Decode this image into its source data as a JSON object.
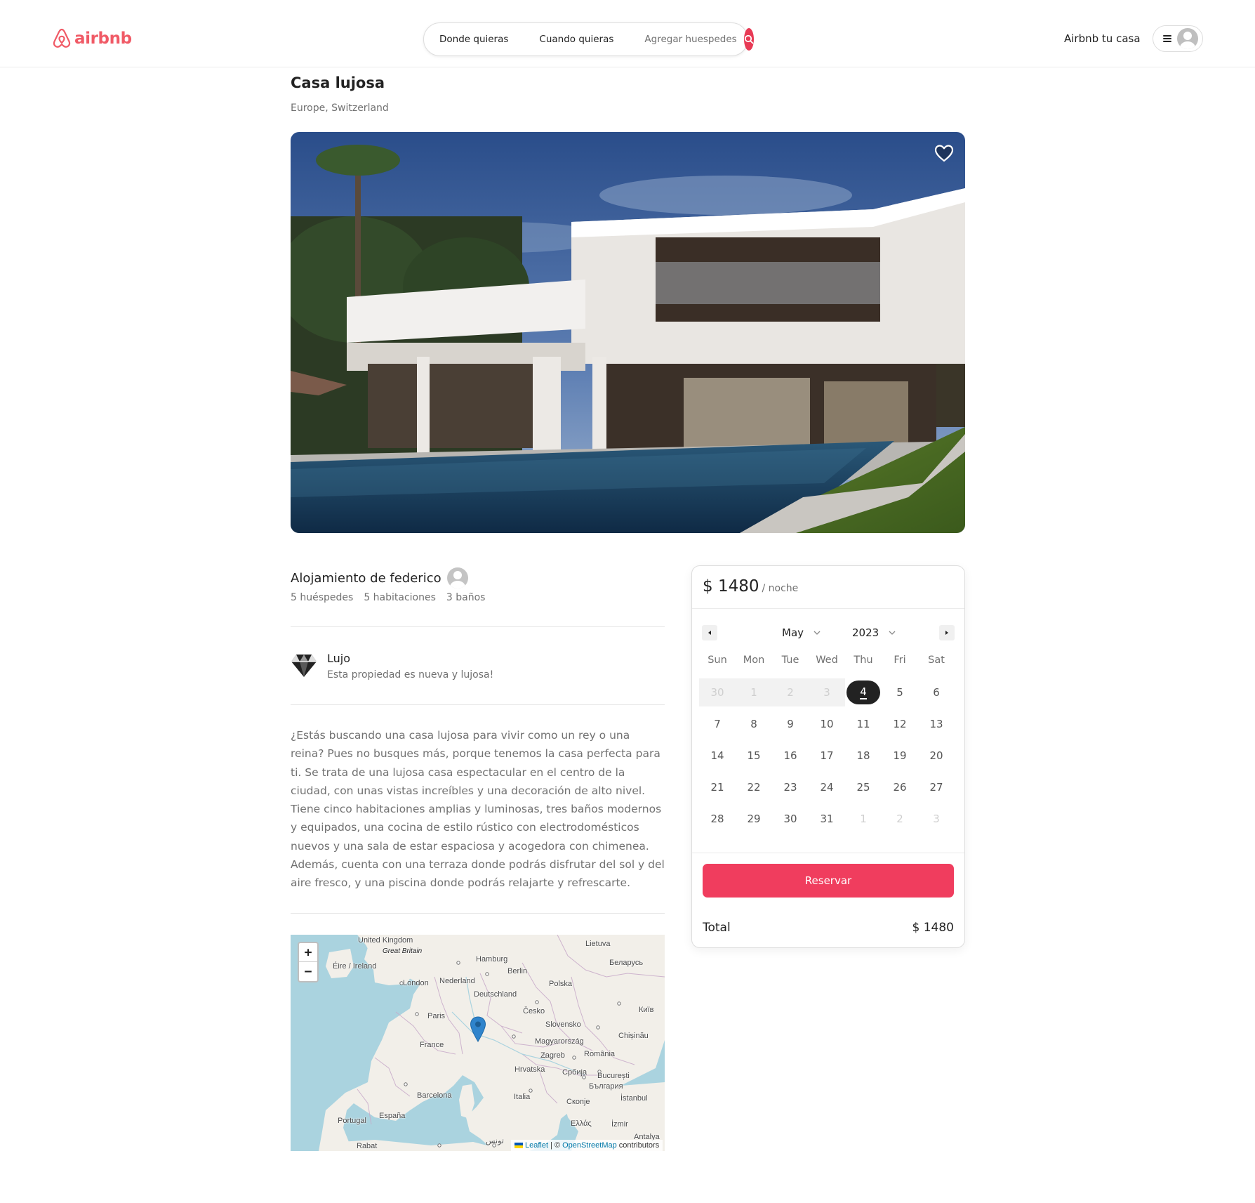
{
  "brand": {
    "name": "airbnb",
    "color": "#f05a66",
    "icon": "airbnb-logo-icon"
  },
  "search": {
    "where": "Donde quieras",
    "when": "Cuando quieras",
    "guests": "Agregar huespedes",
    "button_icon": "search-icon",
    "accent": "#e83a55"
  },
  "nav": {
    "host_link": "Airbnb tu casa",
    "menu_icon": "hamburger-icon",
    "avatar_icon": "user-avatar-icon"
  },
  "listing": {
    "title": "Casa lujosa",
    "location": "Europe, Switzerland",
    "host_line": "Alojamiento de federico",
    "stats": [
      "5 huéspedes",
      "5 habitaciones",
      "3 baños"
    ],
    "amenity": {
      "icon": "diamond-icon",
      "title": "Lujo",
      "description": "Esta propiedad es nueva y lujosa!"
    },
    "description": "¿Estás buscando una casa lujosa para vivir como un rey o una reina? Pues no busques más, porque tenemos la casa perfecta para ti. Se trata de una lujosa casa espectacular en el centro de la ciudad, con unas vistas increíbles y una decoración de alto nivel. Tiene cinco habitaciones amplias y luminosas, tres baños modernos y equipados, una cocina de estilo rústico con electrodomésticos nuevos y una sala de estar espaciosa y acogedora con chimenea. Además, cuenta con una terraza donde podrás disfrutar del sol y del aire fresco, y una piscina donde podrás relajarte y refrescarte."
  },
  "booking": {
    "price": "$ 1480",
    "unit": "/ noche",
    "month": "May",
    "year": "2023",
    "weekdays": [
      "Sun",
      "Mon",
      "Tue",
      "Wed",
      "Thu",
      "Fri",
      "Sat"
    ],
    "weeks": [
      [
        {
          "d": "30",
          "s": "past"
        },
        {
          "d": "1",
          "s": "past"
        },
        {
          "d": "2",
          "s": "past"
        },
        {
          "d": "3",
          "s": "past"
        },
        {
          "d": "4",
          "s": "selected"
        },
        {
          "d": "5",
          "s": ""
        },
        {
          "d": "6",
          "s": ""
        }
      ],
      [
        {
          "d": "7",
          "s": ""
        },
        {
          "d": "8",
          "s": ""
        },
        {
          "d": "9",
          "s": ""
        },
        {
          "d": "10",
          "s": ""
        },
        {
          "d": "11",
          "s": ""
        },
        {
          "d": "12",
          "s": ""
        },
        {
          "d": "13",
          "s": ""
        }
      ],
      [
        {
          "d": "14",
          "s": ""
        },
        {
          "d": "15",
          "s": ""
        },
        {
          "d": "16",
          "s": ""
        },
        {
          "d": "17",
          "s": ""
        },
        {
          "d": "18",
          "s": ""
        },
        {
          "d": "19",
          "s": ""
        },
        {
          "d": "20",
          "s": ""
        }
      ],
      [
        {
          "d": "21",
          "s": ""
        },
        {
          "d": "22",
          "s": ""
        },
        {
          "d": "23",
          "s": ""
        },
        {
          "d": "24",
          "s": ""
        },
        {
          "d": "25",
          "s": ""
        },
        {
          "d": "26",
          "s": ""
        },
        {
          "d": "27",
          "s": ""
        }
      ],
      [
        {
          "d": "28",
          "s": ""
        },
        {
          "d": "29",
          "s": ""
        },
        {
          "d": "30",
          "s": ""
        },
        {
          "d": "31",
          "s": ""
        },
        {
          "d": "1",
          "s": "other"
        },
        {
          "d": "2",
          "s": "other"
        },
        {
          "d": "3",
          "s": "other"
        }
      ]
    ],
    "reserve_label": "Reservar",
    "reserve_color": "#f03d5e",
    "total_label": "Total",
    "total_value": "$ 1480"
  },
  "map": {
    "zoom_in": "+",
    "zoom_out": "−",
    "attribution_leaflet": "Leaflet",
    "attribution_sep": "| ©",
    "attribution_osm": "OpenStreetMap",
    "attribution_tail": "contributors",
    "labels": [
      "United Kingdom",
      "Great Britain",
      "Éire / Ireland",
      "London",
      "Nederland",
      "Hamburg",
      "Berlin",
      "Lietuva",
      "Беларусь",
      "Polska",
      "Deutschland",
      "Česko",
      "Київ",
      "Paris",
      "Slovensko",
      "France",
      "Magyarország",
      "Chișinău",
      "Zagreb",
      "România",
      "Hrvatska",
      "Србија",
      "București",
      "България",
      "Barcelona",
      "Italia",
      "Скопје",
      "İstanbul",
      "Portugal",
      "España",
      "Ελλάς",
      "İzmir",
      "Rabat",
      "تونس",
      "Antalya"
    ]
  }
}
